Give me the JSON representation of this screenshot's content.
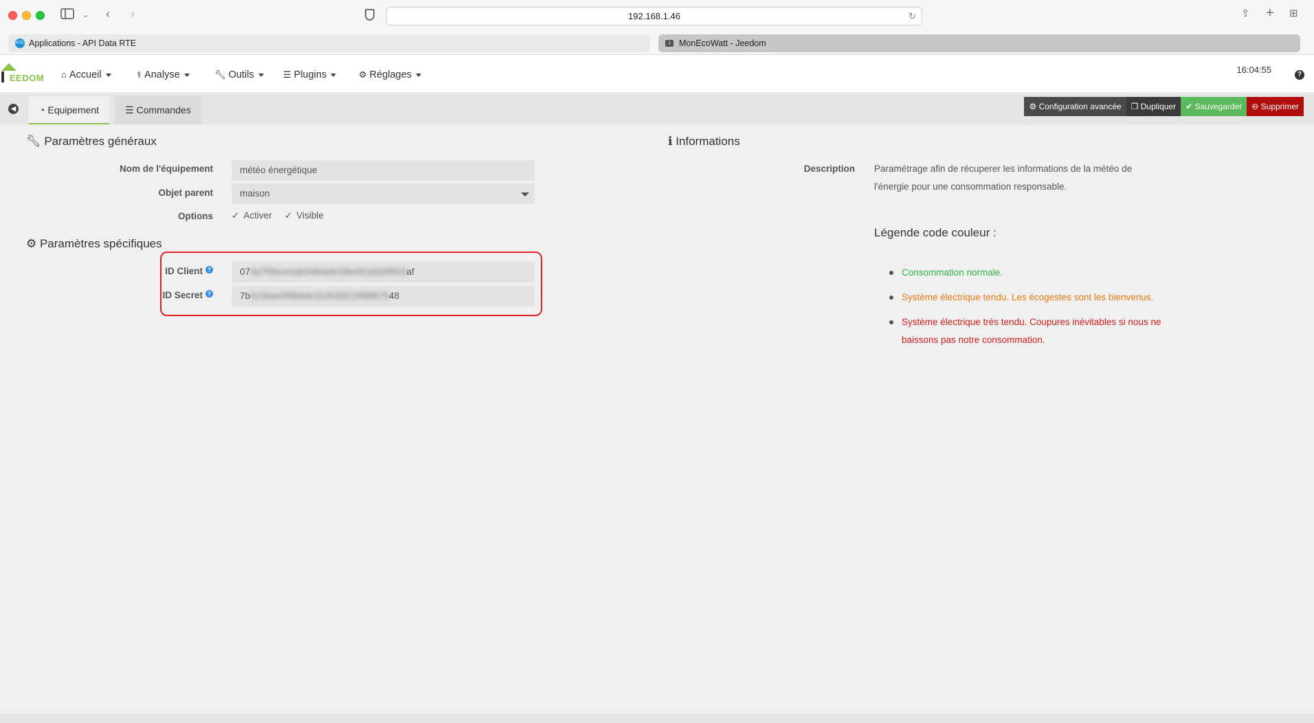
{
  "browser": {
    "url": "192.168.1.46",
    "tabs": [
      {
        "label": "Applications - API Data RTE",
        "favicon": "RTE"
      },
      {
        "label": "MonEcoWatt - Jeedom",
        "favicon": "J"
      }
    ]
  },
  "navbar": {
    "logo_text": "EEDOM",
    "items": [
      {
        "label": "Accueil",
        "icon": "home-icon"
      },
      {
        "label": "Analyse",
        "icon": "stethoscope-icon"
      },
      {
        "label": "Outils",
        "icon": "wrench-icon"
      },
      {
        "label": "Plugins",
        "icon": "tasks-icon"
      },
      {
        "label": "Réglages",
        "icon": "cog-icon"
      }
    ],
    "clock": "16:04:55",
    "help": "?"
  },
  "subbar": {
    "tabs": [
      {
        "label": "Equipement",
        "icon": "tachometer-icon"
      },
      {
        "label": "Commandes",
        "icon": "list-icon"
      }
    ],
    "actions": {
      "config": "Configuration avancée",
      "duplicate": "Dupliquer",
      "save": "Sauvegarder",
      "delete": "Supprimer"
    }
  },
  "general": {
    "title": "Paramètres généraux",
    "name_label": "Nom de l'équipement",
    "name_value": "météo énergétique",
    "parent_label": "Objet parent",
    "parent_value": "maison",
    "options_label": "Options",
    "option_active": "Activer",
    "option_visible": "Visible"
  },
  "specific": {
    "title": "Paramètres spécifiques",
    "client_label": "ID Client",
    "client_prefix": "07",
    "client_suffix": "af",
    "secret_label": "ID Secret",
    "secret_prefix": "7b",
    "secret_suffix": "48"
  },
  "info": {
    "title": "Informations",
    "description_label": "Description",
    "description_text": "Paramétrage afin de récuperer les informations de la météo de l'énergie pour une consommation responsable.",
    "legend_title": "Légende code couleur :",
    "legend": [
      {
        "text": "Consommation normale.",
        "color": "#2eb24b"
      },
      {
        "text": "Système électrique tendu. Les écogestes sont les bienvenus.",
        "color": "#e87a10"
      },
      {
        "text": "Système électrique très tendu. Coupures inévitables si nous ne baissons pas notre consommation.",
        "color": "#d11b1b"
      }
    ]
  }
}
